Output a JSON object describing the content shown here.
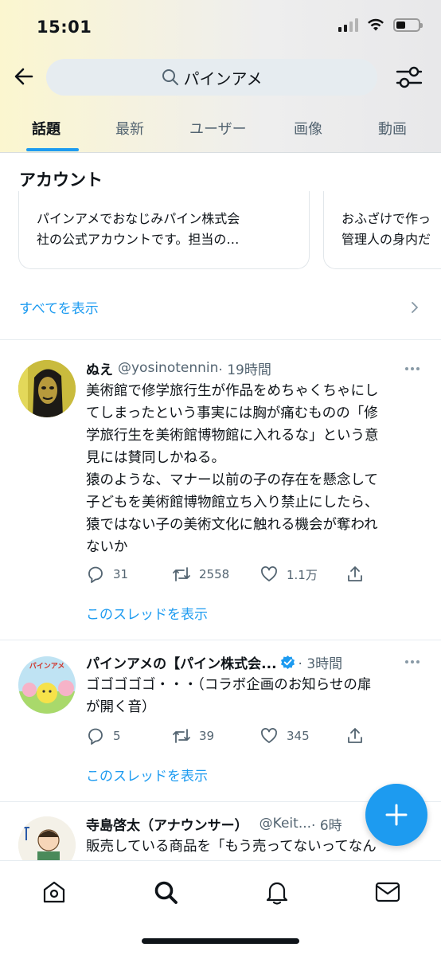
{
  "status_bar": {
    "time": "15:01"
  },
  "search": {
    "query": "パインアメ"
  },
  "tabs": [
    {
      "label": "話題",
      "active": true
    },
    {
      "label": "最新",
      "active": false
    },
    {
      "label": "ユーザー",
      "active": false
    },
    {
      "label": "画像",
      "active": false
    },
    {
      "label": "動画",
      "active": false
    }
  ],
  "accounts": {
    "title": "アカウント",
    "cards": [
      {
        "bio_line1": "パインアメでおなじみパイン株式会",
        "bio_line2": "社の公式アカウントです。担当の…"
      },
      {
        "bio_line1": "おふざけで作っ",
        "bio_line2": "管理人の身内だ"
      }
    ],
    "show_all": "すべてを表示"
  },
  "tweets": [
    {
      "name": "ぬえ",
      "handle": "@yosinotennin",
      "time": "· 19時間",
      "text": "美術館で修学旅行生が作品をめちゃくちゃにし\nてしまったという事実には胸が痛むものの「修\n学旅行生を美術館博物館に入れるな」という意\n見には賛同しかねる。\n猿のような、マナー以前の子の存在を懸念して\n子どもを美術館博物館立ち入り禁止にしたら、\n猿ではない子の美術文化に触れる機会が奪われ\nないか",
      "replies": "31",
      "retweets": "2558",
      "likes": "1.1万",
      "thread_link": "このスレッドを表示"
    },
    {
      "name": "パインアメの【パイン株式会...",
      "handle": "",
      "time": "· 3時間",
      "verified": true,
      "text": "ゴゴゴゴゴ・・・（コラボ企画のお知らせの扉\nが開く音）",
      "replies": "5",
      "retweets": "39",
      "likes": "345",
      "thread_link": "このスレッドを表示",
      "avatar_label": "パインアメ"
    },
    {
      "name": "寺島啓太（アナウンサー）",
      "handle": "@Keit...",
      "time": "· 6時",
      "text": "販売している商品を「もう売ってないってなん"
    }
  ],
  "colors": {
    "accent": "#1d9bf0",
    "secondary_text": "#536471",
    "primary_text": "#0f1419"
  }
}
